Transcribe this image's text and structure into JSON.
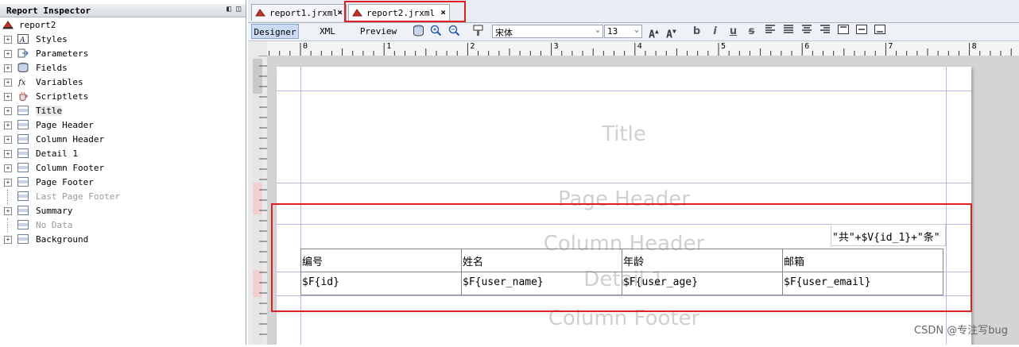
{
  "inspector": {
    "title": "Report Inspector",
    "controls": "◧ ◫",
    "root": "report2",
    "items": [
      {
        "label": "Styles",
        "icon": "styles-icon",
        "expandable": true,
        "dim": false
      },
      {
        "label": "Parameters",
        "icon": "parameters-icon",
        "expandable": true,
        "dim": false
      },
      {
        "label": "Fields",
        "icon": "fields-icon",
        "expandable": true,
        "dim": false
      },
      {
        "label": "Variables",
        "icon": "variables-icon",
        "expandable": true,
        "dim": false
      },
      {
        "label": "Scriptlets",
        "icon": "scriptlets-icon",
        "expandable": true,
        "dim": false
      },
      {
        "label": "Title",
        "icon": "band-icon",
        "expandable": true,
        "dim": false,
        "selected": true
      },
      {
        "label": "Page Header",
        "icon": "band-icon",
        "expandable": true,
        "dim": false
      },
      {
        "label": "Column Header",
        "icon": "band-icon",
        "expandable": true,
        "dim": false
      },
      {
        "label": "Detail 1",
        "icon": "band-icon",
        "expandable": true,
        "dim": false
      },
      {
        "label": "Column Footer",
        "icon": "band-icon",
        "expandable": true,
        "dim": false
      },
      {
        "label": "Page Footer",
        "icon": "band-icon",
        "expandable": true,
        "dim": false
      },
      {
        "label": "Last Page Footer",
        "icon": "band-icon",
        "expandable": false,
        "dim": true
      },
      {
        "label": "Summary",
        "icon": "band-icon",
        "expandable": true,
        "dim": false
      },
      {
        "label": "No Data",
        "icon": "band-icon",
        "expandable": false,
        "dim": true
      },
      {
        "label": "Background",
        "icon": "band-icon",
        "expandable": true,
        "dim": false
      }
    ]
  },
  "tabs": [
    {
      "label": "report1.jrxml",
      "close": "×",
      "active": false
    },
    {
      "label": "report2.jrxml",
      "close": "×",
      "active": true
    }
  ],
  "toolbar": {
    "views": [
      "Designer",
      "XML",
      "Preview"
    ],
    "font_name": "宋体",
    "font_size": "13",
    "format_icons": [
      "b",
      "i",
      "u",
      "s"
    ]
  },
  "ruler": {
    "marks": [
      "0",
      "1",
      "2",
      "3",
      "4",
      "5",
      "6",
      "7",
      "8"
    ]
  },
  "design": {
    "bands": [
      "Title",
      "Page Header",
      "Column Header",
      "Detail 1",
      "Column Footer"
    ],
    "count_expression": "\"共\"+$V{id_1}+\"条\"",
    "headers": [
      "编号",
      "姓名",
      "年龄",
      "邮箱"
    ],
    "fields": [
      "$F{id}",
      "$F{user_name}",
      "$F{user_age}",
      "$F{user_email}"
    ]
  },
  "watermark": "CSDN @专注写bug",
  "colors": {
    "highlight": "#e02020",
    "active_view": "#c9daf2",
    "guides": "#b8b8e6"
  }
}
